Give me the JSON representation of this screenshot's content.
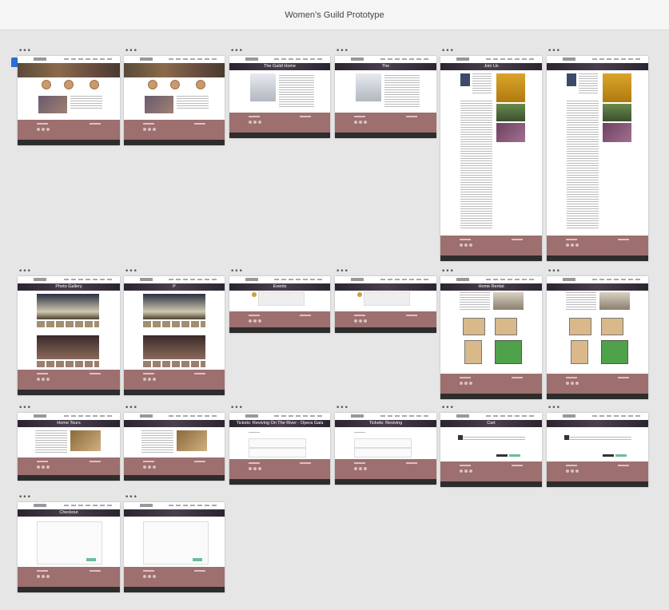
{
  "window": {
    "title": "Women’s Guild Prototype"
  },
  "artboard_menu_glyph": "•••",
  "artboards": [
    {
      "id": "home-1",
      "banner": ""
    },
    {
      "id": "home-2",
      "banner": ""
    },
    {
      "id": "guild-home-1",
      "banner": "The Guild Home"
    },
    {
      "id": "guild-home-2",
      "banner": "The"
    },
    {
      "id": "join-us-1",
      "banner": "Join Us"
    },
    {
      "id": "join-us-2",
      "banner": ""
    },
    {
      "id": "photo-gallery-1",
      "banner": "Photo Gallery"
    },
    {
      "id": "photo-gallery-2",
      "banner": "P"
    },
    {
      "id": "events-1",
      "banner": "Events"
    },
    {
      "id": "events-2",
      "banner": ""
    },
    {
      "id": "home-rental-1",
      "banner": "Home Rental"
    },
    {
      "id": "home-rental-2",
      "banner": ""
    },
    {
      "id": "home-tours-1",
      "banner": "Home Tours"
    },
    {
      "id": "home-tours-2",
      "banner": ""
    },
    {
      "id": "tickets-1",
      "banner": "Tickets: Reviving On The River - Opera Gala"
    },
    {
      "id": "tickets-2",
      "banner": "Tickets: Reviving"
    },
    {
      "id": "cart-1",
      "banner": "Cart"
    },
    {
      "id": "cart-2",
      "banner": ""
    },
    {
      "id": "checkout-1",
      "banner": "Checkout"
    },
    {
      "id": "checkout-2",
      "banner": ""
    }
  ],
  "colors": {
    "footer": "#9d6f6f",
    "banner": "#3a3240",
    "accent_button": "#6abd9a",
    "selection_marker": "#2a6fd6"
  }
}
